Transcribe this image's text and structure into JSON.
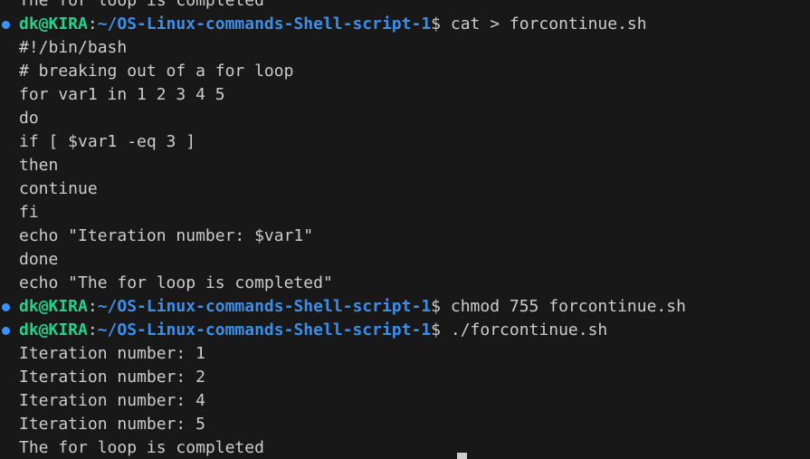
{
  "terminal": {
    "prompt_user": "dk@KIRA",
    "prompt_sep": ":",
    "prompt_path": "~/OS-Linux-commands-Shell-script-1",
    "prompt_symbol": "$ ",
    "top_partial_line": "The for loop is completed",
    "commands": [
      "cat > forcontinue.sh",
      "chmod 755 forcontinue.sh",
      "./forcontinue.sh"
    ],
    "script_lines": [
      "#!/bin/bash",
      "# breaking out of a for loop",
      "for var1 in 1 2 3 4 5",
      "do",
      "if [ $var1 -eq 3 ]",
      "then",
      "continue",
      "fi",
      "echo \"Iteration number: $var1\"",
      "done",
      "echo \"The for loop is completed\""
    ],
    "output_lines": [
      "Iteration number: 1",
      "Iteration number: 2",
      "Iteration number: 4",
      "Iteration number: 5",
      "The for loop is completed"
    ],
    "colors": {
      "background": "#181818",
      "text": "#cccccc",
      "user": "#23d18b",
      "path": "#3b8eea",
      "decoration_dot": "#3794ff"
    }
  }
}
